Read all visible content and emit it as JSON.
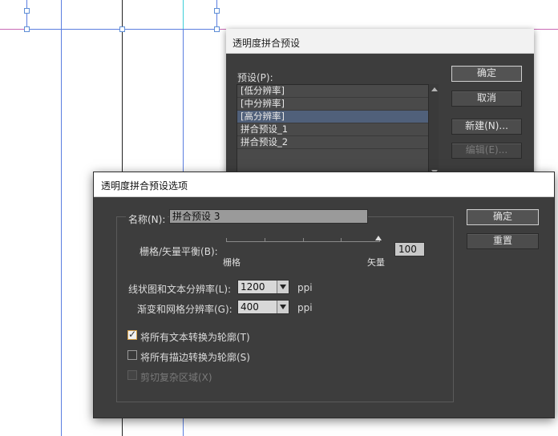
{
  "back_dialog": {
    "title": "透明度拼合预设",
    "preset_label": "预设(P):",
    "presets": [
      "[低分辨率]",
      "[中分辨率]",
      "[高分辨率]",
      "拼合预设_1",
      "拼合预设_2"
    ],
    "selected_index": 2,
    "buttons": {
      "ok": "确定",
      "cancel": "取消",
      "new": "新建(N)...",
      "edit": "编辑(E)..."
    }
  },
  "front_dialog": {
    "title": "透明度拼合预设选项",
    "name_label": "名称(N):",
    "name_value": "拼合预设 3",
    "balance_label": "栅格/矢量平衡(B):",
    "balance_min_label": "栅格",
    "balance_max_label": "矢量",
    "balance_value": "100",
    "line_res_label": "线状图和文本分辨率(L):",
    "line_res_value": "1200",
    "gradient_res_label": "渐变和网格分辨率(G):",
    "gradient_res_value": "400",
    "unit": "ppi",
    "checkboxes": [
      {
        "label": "将所有文本转换为轮廓(T)",
        "checked": true,
        "enabled": true
      },
      {
        "label": "将所有描边转换为轮廓(S)",
        "checked": false,
        "enabled": true
      },
      {
        "label": "剪切复杂区域(X)",
        "checked": false,
        "enabled": false
      }
    ],
    "buttons": {
      "ok": "确定",
      "reset": "重置"
    }
  },
  "colors": {
    "dialog_bg": "#3d3d3d",
    "selection": "#50607a",
    "guide_magenta": "#c86ab4",
    "guide_cyan": "#3ccfd8",
    "guide_blue": "#5b7ee0"
  }
}
